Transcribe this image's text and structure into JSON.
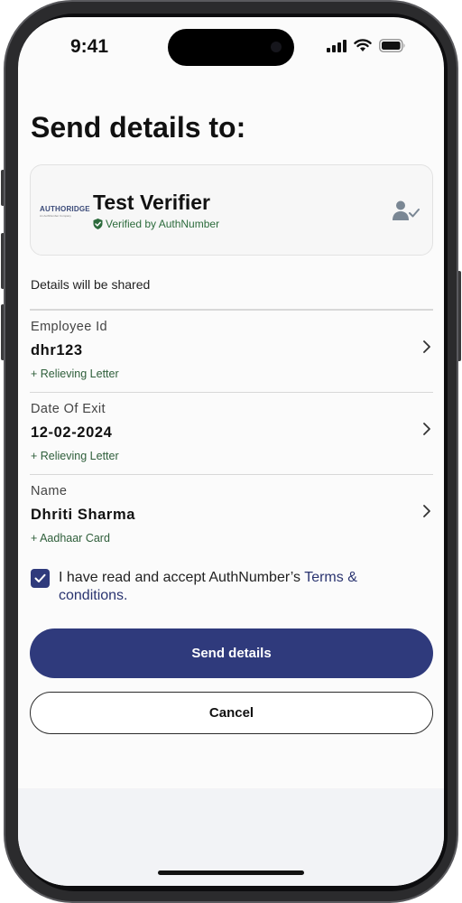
{
  "status_bar": {
    "time": "9:41",
    "icons": [
      "cellular-signal-icon",
      "wifi-icon",
      "battery-icon"
    ]
  },
  "page": {
    "title": "Send details to:"
  },
  "verifier": {
    "logo_text": "AUTHORIDGE",
    "logo_subtext": "An AuthNumber Company",
    "name": "Test Verifier",
    "verified_text": "Verified by AuthNumber",
    "icons": [
      "verified-badge-icon",
      "user-verified-icon"
    ]
  },
  "shared_label": "Details will be shared",
  "fields": [
    {
      "label": "Employee Id",
      "value": "dhr123",
      "source": "+ Relieving Letter"
    },
    {
      "label": "Date Of Exit",
      "value": "12-02-2024",
      "source": "+ Relieving Letter"
    },
    {
      "label": "Name",
      "value": "Dhriti Sharma",
      "source": "+ Aadhaar Card"
    }
  ],
  "consent": {
    "checked": true,
    "text_prefix": "I have read and accept AuthNumber’s ",
    "link_text": "Terms & conditions."
  },
  "buttons": {
    "primary": "Send details",
    "secondary": "Cancel"
  },
  "colors": {
    "primary": "#2f3a7c",
    "verified_green": "#2c6b3c",
    "source_green": "#2e5e3a"
  }
}
